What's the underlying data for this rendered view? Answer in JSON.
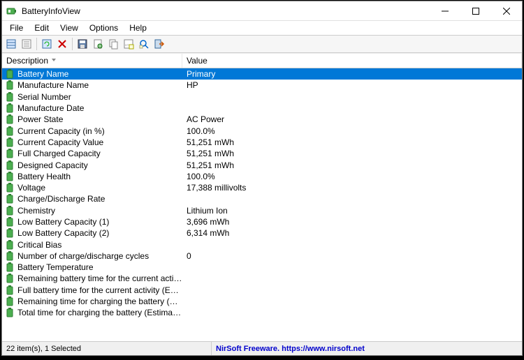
{
  "window": {
    "title": "BatteryInfoView"
  },
  "menu": {
    "file": "File",
    "edit": "Edit",
    "view": "View",
    "options": "Options",
    "help": "Help"
  },
  "columns": {
    "description": "Description",
    "value": "Value"
  },
  "rows": [
    {
      "desc": "Battery Name",
      "val": "Primary",
      "selected": true
    },
    {
      "desc": "Manufacture Name",
      "val": "HP"
    },
    {
      "desc": "Serial Number",
      "val": ""
    },
    {
      "desc": "Manufacture Date",
      "val": ""
    },
    {
      "desc": "Power State",
      "val": "AC Power"
    },
    {
      "desc": "Current Capacity (in %)",
      "val": "100.0%"
    },
    {
      "desc": "Current Capacity Value",
      "val": "51,251 mWh"
    },
    {
      "desc": "Full Charged Capacity",
      "val": "51,251 mWh"
    },
    {
      "desc": "Designed Capacity",
      "val": "51,251 mWh"
    },
    {
      "desc": "Battery Health",
      "val": "100.0%"
    },
    {
      "desc": "Voltage",
      "val": "17,388 millivolts"
    },
    {
      "desc": "Charge/Discharge Rate",
      "val": ""
    },
    {
      "desc": "Chemistry",
      "val": "Lithium Ion"
    },
    {
      "desc": "Low Battery Capacity (1)",
      "val": "3,696 mWh"
    },
    {
      "desc": "Low Battery Capacity (2)",
      "val": "6,314 mWh"
    },
    {
      "desc": "Critical Bias",
      "val": ""
    },
    {
      "desc": "Number of charge/discharge cycles",
      "val": "0"
    },
    {
      "desc": "Battery Temperature",
      "val": ""
    },
    {
      "desc": "Remaining battery time for the current activity (Est...",
      "val": ""
    },
    {
      "desc": "Full battery time for the current activity (Estimated)",
      "val": ""
    },
    {
      "desc": "Remaining time for charging the battery (Estimated)",
      "val": ""
    },
    {
      "desc": "Total  time for charging the battery (Estimated)",
      "val": ""
    }
  ],
  "status": {
    "items": "22 item(s), 1 Selected",
    "credit": "NirSoft Freeware. https://www.nirsoft.net"
  }
}
